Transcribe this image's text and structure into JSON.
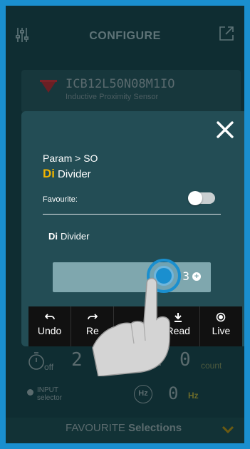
{
  "header": {
    "title": "CONFIGURE"
  },
  "device": {
    "model": "ICB12L50N08M1IO",
    "description": "Inductive Proximity Sensor"
  },
  "background_rows": {
    "timer_state": "off",
    "timer_value": "2",
    "counter_value": "0",
    "counter_unit": "count",
    "input_label_line1": "INPUT",
    "input_label_line2": "selector",
    "freq_icon_text": "Hz",
    "freq_value": "0",
    "freq_unit": "Hz"
  },
  "favourites_bar": {
    "label_prefix": "FAVOURITE",
    "label_bold": "Selections"
  },
  "modal": {
    "breadcrumb": "Param > SO",
    "param_code": "Di",
    "param_name": "Divider",
    "favourite_label": "Favourite:",
    "favourite_on": false,
    "field_code": "Di",
    "field_name": "Divider",
    "slider_value": "3",
    "slider_plus": "+"
  },
  "toolbar": {
    "buttons": [
      {
        "label": "Undo",
        "icon": "undo-icon"
      },
      {
        "label": "Re",
        "icon": "redo-icon"
      },
      {
        "label": "",
        "icon": "hidden"
      },
      {
        "label": "Read",
        "icon": "download-icon"
      },
      {
        "label": "Live",
        "icon": "live-icon"
      }
    ]
  },
  "colors": {
    "frame": "#1a8fcf",
    "accent_yellow": "#f0b400",
    "modal_bg": "#234d55"
  }
}
